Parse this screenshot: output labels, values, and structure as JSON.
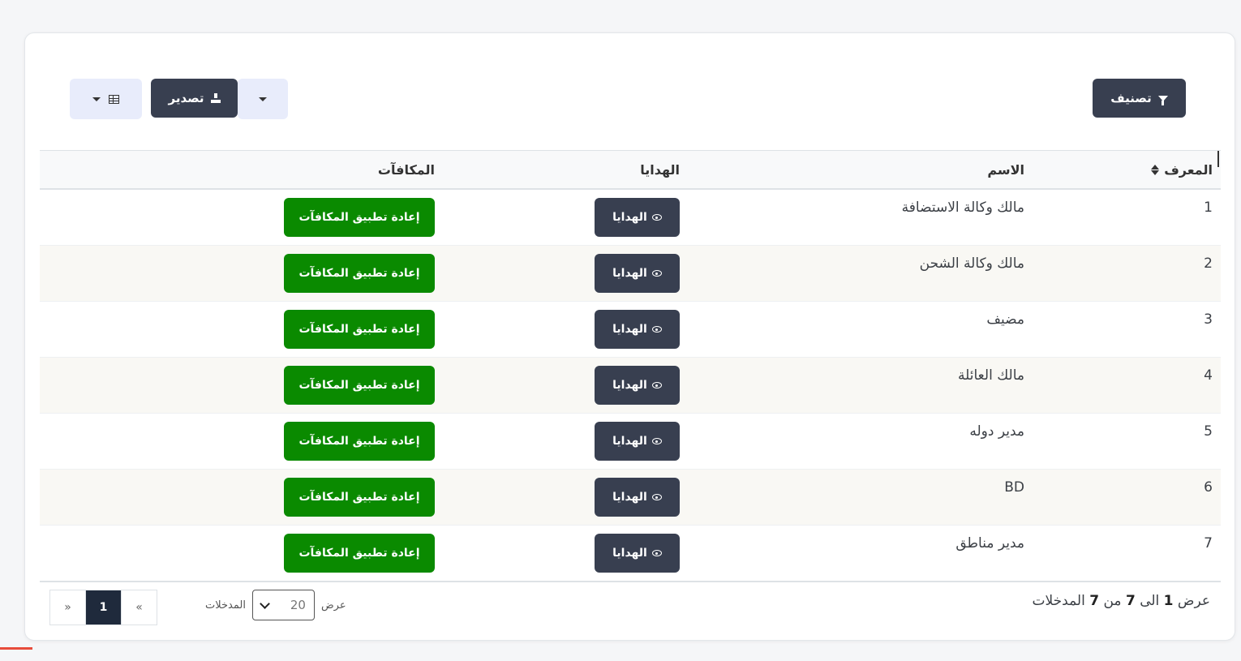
{
  "toolbar": {
    "filter_label": "تصنيف",
    "export_label": "تصدير"
  },
  "table": {
    "headers": {
      "id": "المعرف",
      "name": "الاسم",
      "gifts": "الهدايا",
      "rewards": "المكافآت"
    },
    "rows": [
      {
        "id": "1",
        "name": "مالك وكالة الاستضافة",
        "gift_btn": "الهدايا",
        "reward_btn": "إعادة تطبيق المكافآت"
      },
      {
        "id": "2",
        "name": "مالك وكالة الشحن",
        "gift_btn": "الهدايا",
        "reward_btn": "إعادة تطبيق المكافآت"
      },
      {
        "id": "3",
        "name": "مضيف",
        "gift_btn": "الهدايا",
        "reward_btn": "إعادة تطبيق المكافآت"
      },
      {
        "id": "4",
        "name": "مالك العائلة",
        "gift_btn": "الهدايا",
        "reward_btn": "إعادة تطبيق المكافآت"
      },
      {
        "id": "5",
        "name": "مدير دوله",
        "gift_btn": "الهدايا",
        "reward_btn": "إعادة تطبيق المكافآت"
      },
      {
        "id": "6",
        "name": "BD",
        "gift_btn": "الهدايا",
        "reward_btn": "إعادة تطبيق المكافآت"
      },
      {
        "id": "7",
        "name": "مدير مناطق",
        "gift_btn": "الهدايا",
        "reward_btn": "إعادة تطبيق المكافآت"
      }
    ]
  },
  "footer": {
    "summary_prefix": "عرض",
    "from": "1",
    "to_word": "الى",
    "to": "7",
    "of_word": "من",
    "total": "7",
    "suffix": "المدخلات",
    "length_show": "عرض",
    "length_value": "20",
    "length_entries": "المدخلات"
  },
  "pagination": {
    "prev": "«",
    "current": "1",
    "next": "»"
  },
  "colors": {
    "dark_button": "#383f50",
    "green_button": "#0a8a00",
    "light_button": "#e8ecfb",
    "active_page": "#1f2a3c"
  },
  "icons": [
    "filter-icon",
    "download-icon",
    "caret-down-icon",
    "table-grid-icon",
    "eye-icon",
    "sort-icon",
    "chevron-down-icon"
  ]
}
